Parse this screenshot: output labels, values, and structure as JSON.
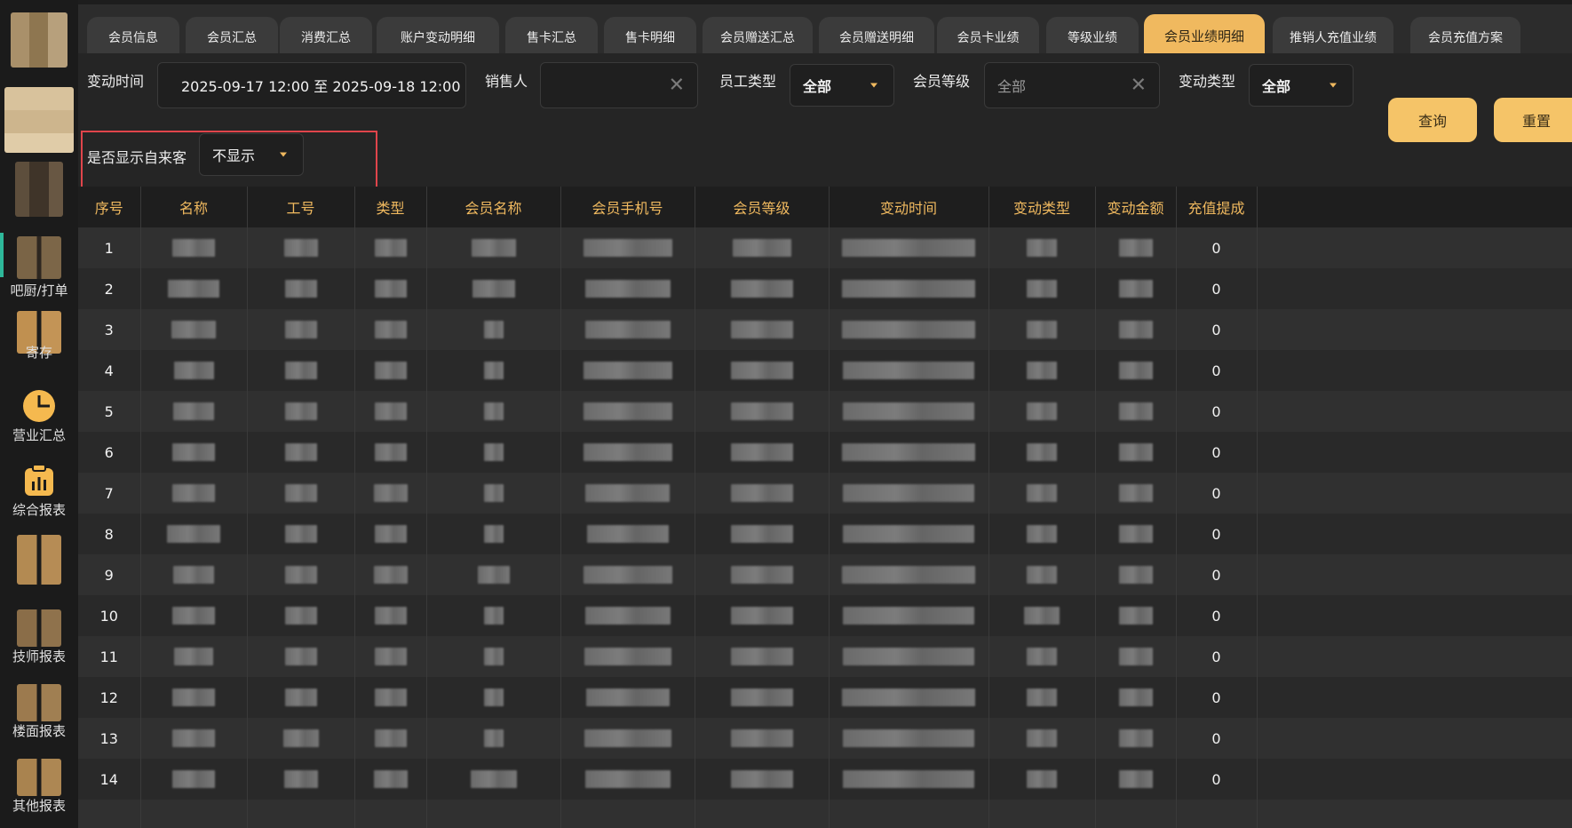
{
  "sidebar": {
    "items": [
      {
        "label": ""
      },
      {
        "label": ""
      },
      {
        "label": ""
      },
      {
        "label": "吧厨/打单"
      },
      {
        "label": "寄存"
      },
      {
        "label": "营业汇总",
        "icon": "pie-chart-icon"
      },
      {
        "label": "综合报表",
        "icon": "report-icon"
      },
      {
        "label": ""
      },
      {
        "label": "技师报表"
      },
      {
        "label": "楼面报表"
      },
      {
        "label": "其他报表"
      }
    ]
  },
  "tabs": [
    {
      "label": "会员信息"
    },
    {
      "label": "会员汇总"
    },
    {
      "label": "消费汇总"
    },
    {
      "label": "账户变动明细"
    },
    {
      "label": "售卡汇总"
    },
    {
      "label": "售卡明细"
    },
    {
      "label": "会员赠送汇总"
    },
    {
      "label": "会员赠送明细"
    },
    {
      "label": "会员卡业绩"
    },
    {
      "label": "等级业绩"
    },
    {
      "label": "会员业绩明细",
      "active": true
    },
    {
      "label": "推销人充值业绩"
    },
    {
      "label": "会员充值方案"
    }
  ],
  "filters": {
    "change_time_label": "变动时间",
    "change_time_value": "2025-09-17 12:00 至 2025-09-18 12:00",
    "seller_label": "销售人",
    "seller_value": "",
    "staff_type_label": "员工类型",
    "staff_type_value": "全部",
    "member_level_label": "会员等级",
    "member_level_placeholder": "全部",
    "change_type_label": "变动类型",
    "change_type_value": "全部",
    "walkin_label": "是否显示自来客",
    "walkin_value": "不显示",
    "query_button": "查询",
    "reset_button": "重置"
  },
  "table": {
    "columns": [
      "序号",
      "名称",
      "工号",
      "类型",
      "会员名称",
      "会员手机号",
      "会员等级",
      "变动时间",
      "变动类型",
      "变动金额",
      "充值提成"
    ],
    "rows": [
      {
        "index": "1",
        "commission": "0"
      },
      {
        "index": "2",
        "commission": "0"
      },
      {
        "index": "3",
        "commission": "0"
      },
      {
        "index": "4",
        "commission": "0"
      },
      {
        "index": "5",
        "commission": "0"
      },
      {
        "index": "6",
        "commission": "0"
      },
      {
        "index": "7",
        "commission": "0"
      },
      {
        "index": "8",
        "commission": "0"
      },
      {
        "index": "9",
        "commission": "0"
      },
      {
        "index": "10",
        "commission": "0"
      },
      {
        "index": "11",
        "commission": "0"
      },
      {
        "index": "12",
        "commission": "0"
      },
      {
        "index": "13",
        "commission": "0"
      },
      {
        "index": "14",
        "commission": "0"
      }
    ]
  },
  "colors": {
    "accent": "#f0b95f",
    "background": "#262626",
    "highlight_border": "#e0454b",
    "sidebar_active": "#2eb89a"
  }
}
